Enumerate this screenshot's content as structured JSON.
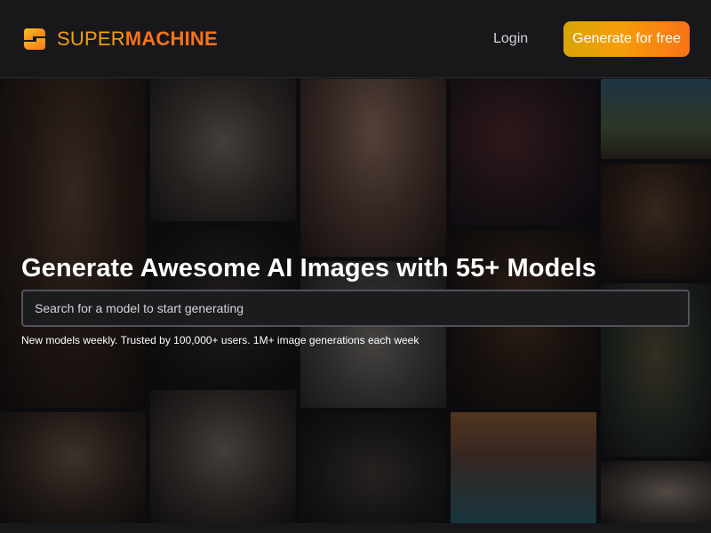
{
  "brand": {
    "name_part1": "SUPER",
    "name_part2": "MACHINE"
  },
  "nav": {
    "login_label": "Login",
    "cta_label": "Generate for free"
  },
  "hero": {
    "headline": "Generate Awesome AI Images with 55+ Models",
    "search_placeholder": "Search for a model to start generating",
    "subtext": "New models weekly. Trusted by 100,000+ users. 1M+ image generations each week"
  },
  "gallery": {
    "images": [
      "girl-with-cat",
      "lion-carving",
      "ice-cream-cone",
      "couple-at-night",
      "man-on-hill",
      "portrait-back",
      "butterfly-sketch",
      "elf-portrait",
      "old-wizard",
      "isometric-island",
      "astronaut-on-chair",
      "forest-silhouette",
      "old-man-portrait"
    ]
  },
  "colors": {
    "accent_gold": "#f59e0b",
    "accent_orange": "#f97316",
    "background": "#18181b"
  }
}
